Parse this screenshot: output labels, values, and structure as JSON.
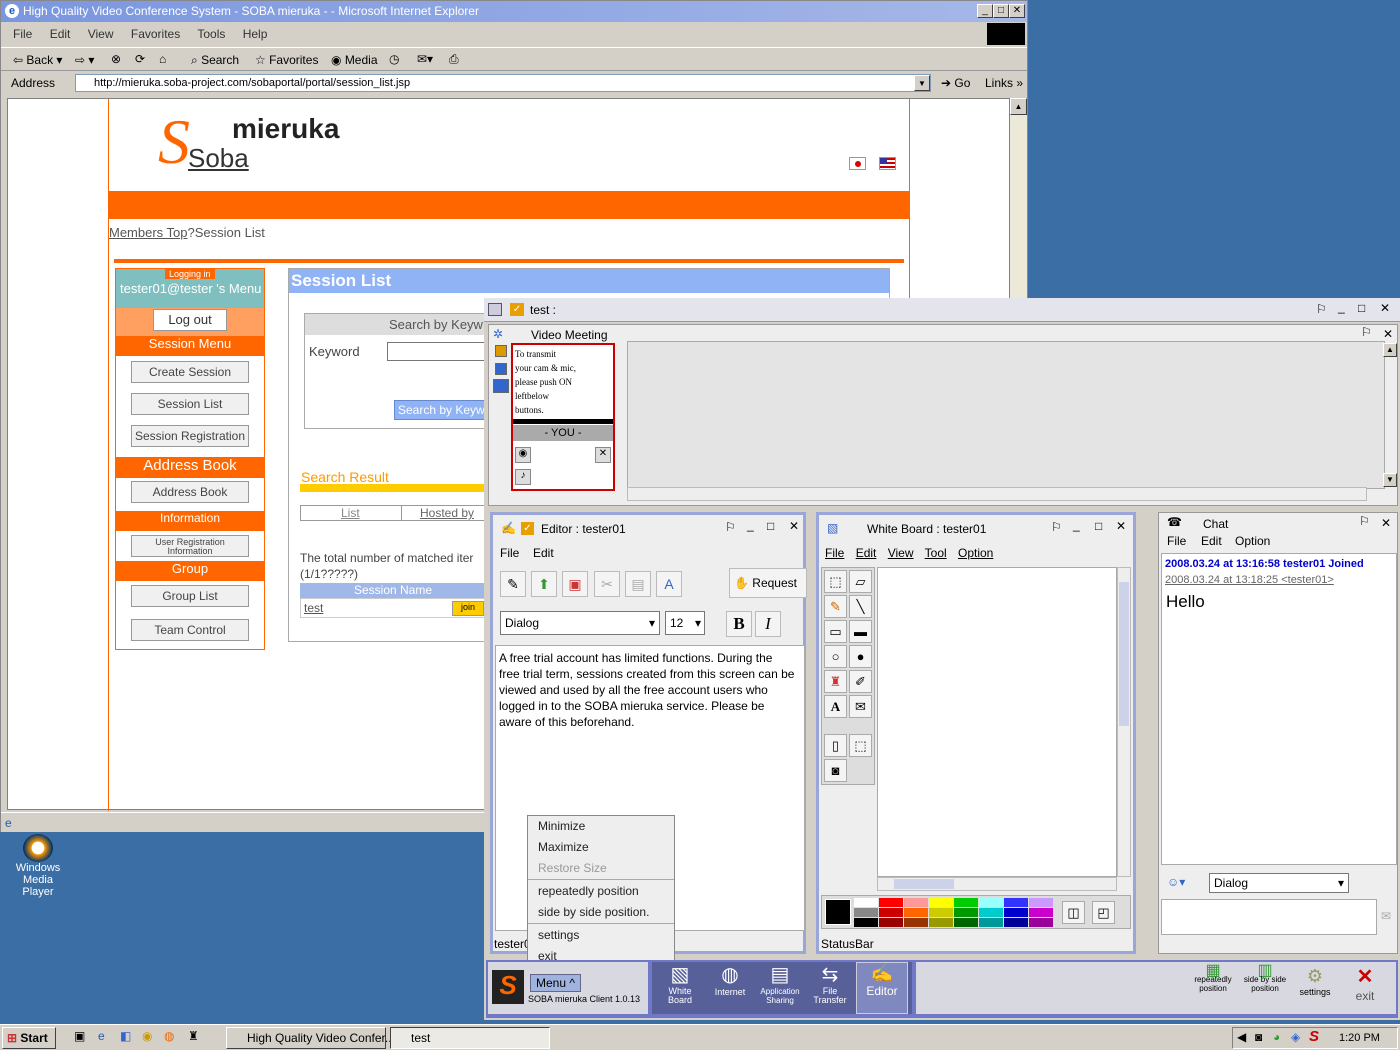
{
  "ie": {
    "title": "High Quality Video Conference System - SOBA mieruka - - Microsoft Internet Explorer",
    "menu": [
      "File",
      "Edit",
      "View",
      "Favorites",
      "Tools",
      "Help"
    ],
    "toolbar": {
      "back": "Back",
      "search": "Search",
      "favorites": "Favorites",
      "media": "Media"
    },
    "address_label": "Address",
    "url": "http://mieruka.soba-project.com/sobaportal/portal/session_list.jsp",
    "go": "Go",
    "links": "Links"
  },
  "portal": {
    "logo": "mieruka",
    "logo_soba": "Soba",
    "breadcrumb_link": "Members Top",
    "breadcrumb_rest": "?Session List",
    "logging_in": "Logging in",
    "user_menu": "tester01@tester 's Menu",
    "logout": "Log out",
    "session_menu": "Session Menu",
    "create_session": "Create Session",
    "session_list_btn": "Session List",
    "session_registration": "Session Registration",
    "address_book_hdr": "Address Book",
    "address_book_btn": "Address Book",
    "information_hdr": "Information",
    "user_reg_info_1": "User Registration",
    "user_reg_info_2": "Information",
    "group_hdr": "Group",
    "group_list": "Group List",
    "team_control": "Team Control",
    "session_list_title": "Session List",
    "search_by_keyword_hdr": "Search by Keyw",
    "keyword_label": "Keyword",
    "search_btn": "Search by Keywo",
    "search_result": "Search Result",
    "col_list": "List",
    "col_hosted": "Hosted by",
    "matched": "The total number of matched iter",
    "paging": "(1/1?????)",
    "session_name_hdr": "Session Name",
    "session_test": "test",
    "join": "join"
  },
  "soba": {
    "window_title": "test :",
    "video_meeting": "Video Meeting",
    "transmit_note": [
      "To transmit",
      "your cam & mic,",
      "please push ON",
      "leftbelow",
      "buttons."
    ],
    "you": "- YOU -",
    "editor_title": "Editor : tester01",
    "editor_menu": [
      "File",
      "Edit"
    ],
    "request": "Request",
    "font": "Dialog",
    "font_size": "12",
    "bold": "B",
    "italic": "I",
    "editor_text": "A free trial account has limited functions. During the free trial term, sessions created from this screen can be viewed and used by all the free account users who logged in to the SOBA mieruka service. Please be aware of this beforehand.",
    "editor_status": "tester0",
    "wb_title": "White Board : tester01",
    "wb_menu": [
      "File",
      "Edit",
      "View",
      "Tool",
      "Option"
    ],
    "wb_status": "StatusBar",
    "chat_title": "Chat",
    "chat_menu": [
      "File",
      "Edit",
      "Option"
    ],
    "chat_joined": "2008.03.24 at 13:16:58 tester01 Joined",
    "chat_msg_meta": "2008.03.24 at 13:18:25 <tester01>",
    "chat_msg": "Hello",
    "chat_font": "Dialog",
    "context_menu": [
      "Minimize",
      "Maximize",
      "Restore Size",
      "repeatedly position",
      "side by side position.",
      "settings",
      "exit"
    ],
    "menu_btn": "Menu ^",
    "client_version": "SOBA mieruka Client 1.0.13",
    "dock": [
      "White Board",
      "Internet",
      "Application Sharing",
      "File Transfer",
      "Editor"
    ],
    "dock_right": [
      "repeatedly position",
      "side by side position",
      "settings",
      "exit"
    ]
  },
  "desktop": {
    "wmp_1": "Windows",
    "wmp_2": "Media Player"
  },
  "taskbar": {
    "start": "Start",
    "task1": "High Quality Video Confer...",
    "task2": "test",
    "clock": "1:20 PM"
  },
  "colors": {
    "accent": "#ff6600",
    "title_blue": "#7a96df",
    "link_blue": "#0000cc"
  }
}
